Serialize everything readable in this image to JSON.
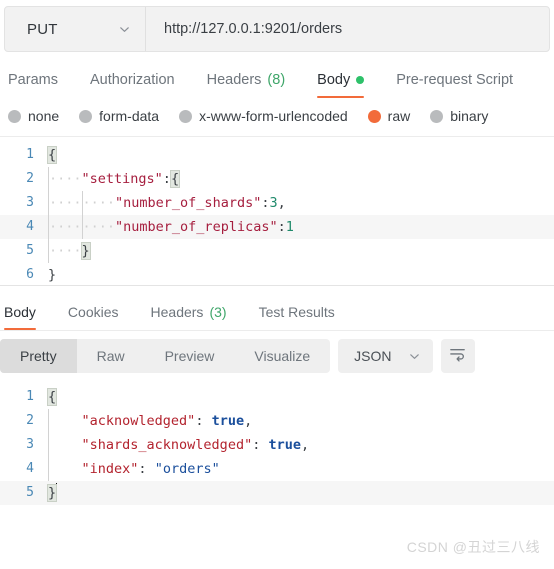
{
  "request_bar": {
    "method": "PUT",
    "method_chevron": "chevron-down-icon",
    "url": "http://127.0.0.1:9201/orders"
  },
  "request_tabs": [
    {
      "label": "Params",
      "active": false
    },
    {
      "label": "Authorization",
      "active": false
    },
    {
      "label": "Headers",
      "count": "(8)",
      "active": false
    },
    {
      "label": "Body",
      "active": true,
      "dot": true
    },
    {
      "label": "Pre-request Script",
      "active": false
    }
  ],
  "body_types": [
    {
      "label": "none",
      "selected": false
    },
    {
      "label": "form-data",
      "selected": false
    },
    {
      "label": "x-www-form-urlencoded",
      "selected": false
    },
    {
      "label": "raw",
      "selected": true
    },
    {
      "label": "binary",
      "selected": false
    }
  ],
  "request_editor": {
    "lines": [
      "1",
      "2",
      "3",
      "4",
      "5",
      "6"
    ],
    "content": [
      "{",
      "    \"settings\":{",
      "        \"number_of_shards\":3,",
      "        \"number_of_replicas\":1",
      "    }",
      "}"
    ]
  },
  "response_tabs": [
    {
      "label": "Body",
      "active": true
    },
    {
      "label": "Cookies",
      "active": false
    },
    {
      "label": "Headers",
      "count": "(3)",
      "active": false
    },
    {
      "label": "Test Results",
      "active": false
    }
  ],
  "format_toolbar": {
    "segments": [
      {
        "label": "Pretty",
        "selected": true
      },
      {
        "label": "Raw",
        "selected": false
      },
      {
        "label": "Preview",
        "selected": false
      },
      {
        "label": "Visualize",
        "selected": false
      }
    ],
    "language": "JSON",
    "language_chevron": "chevron-down-icon",
    "wrap_button": "wrap-text-icon"
  },
  "response_editor": {
    "lines": [
      "1",
      "2",
      "3",
      "4",
      "5"
    ],
    "content": [
      "{",
      "    \"acknowledged\": true,",
      "    \"shards_acknowledged\": true,",
      "    \"index\": \"orders\"",
      "}"
    ],
    "tokens": {
      "key_acknowledged": "\"acknowledged\"",
      "key_shards": "\"shards_acknowledged\"",
      "key_index": "\"index\"",
      "val_true": "true",
      "val_orders": "\"orders\""
    }
  },
  "watermark": "CSDN @丑过三八线"
}
